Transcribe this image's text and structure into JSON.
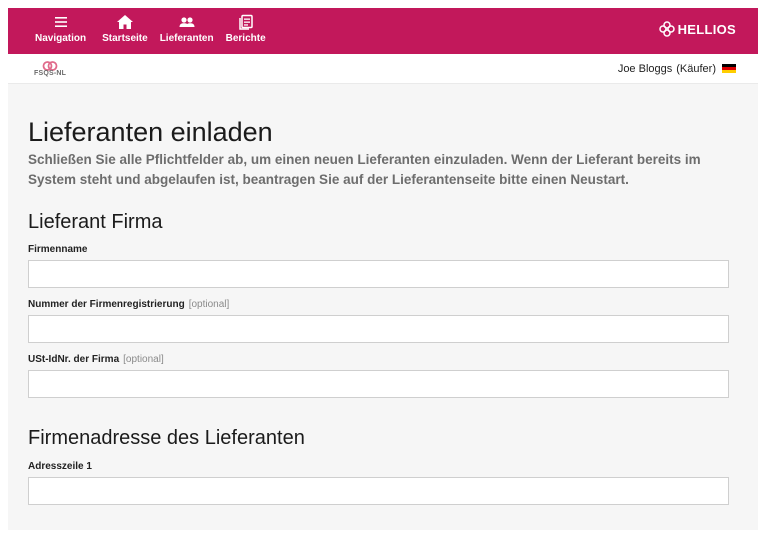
{
  "topbar": {
    "nav": [
      {
        "label": "Navigation",
        "icon": "menu-icon"
      },
      {
        "label": "Startseite",
        "icon": "home-icon"
      },
      {
        "label": "Lieferanten",
        "icon": "users-icon"
      },
      {
        "label": "Berichte",
        "icon": "reports-icon"
      }
    ],
    "brand": "HELLIOS",
    "color": "#c2185b"
  },
  "subbar": {
    "org_logo_text": "FSQS-NL",
    "user_name": "Joe Bloggs",
    "user_role": "(Käufer)",
    "flag": "germany-flag"
  },
  "page": {
    "title": "Lieferanten einladen",
    "intro": "Schließen Sie alle Pflichtfelder ab, um einen neuen Lieferanten einzuladen. Wenn der Lieferant bereits im System steht und abgelaufen ist, beantragen Sie auf der Lieferantenseite bitte einen Neustart."
  },
  "sections": [
    {
      "heading": "Lieferant Firma",
      "fields": [
        {
          "label": "Firmenname",
          "optional": "",
          "value": ""
        },
        {
          "label": "Nummer der Firmenregistrierung",
          "optional": "[optional]",
          "value": ""
        },
        {
          "label": "USt-IdNr. der Firma",
          "optional": "[optional]",
          "value": ""
        }
      ]
    },
    {
      "heading": "Firmenadresse des Lieferanten",
      "fields": [
        {
          "label": "Adresszeile 1",
          "optional": "",
          "value": ""
        }
      ]
    }
  ]
}
